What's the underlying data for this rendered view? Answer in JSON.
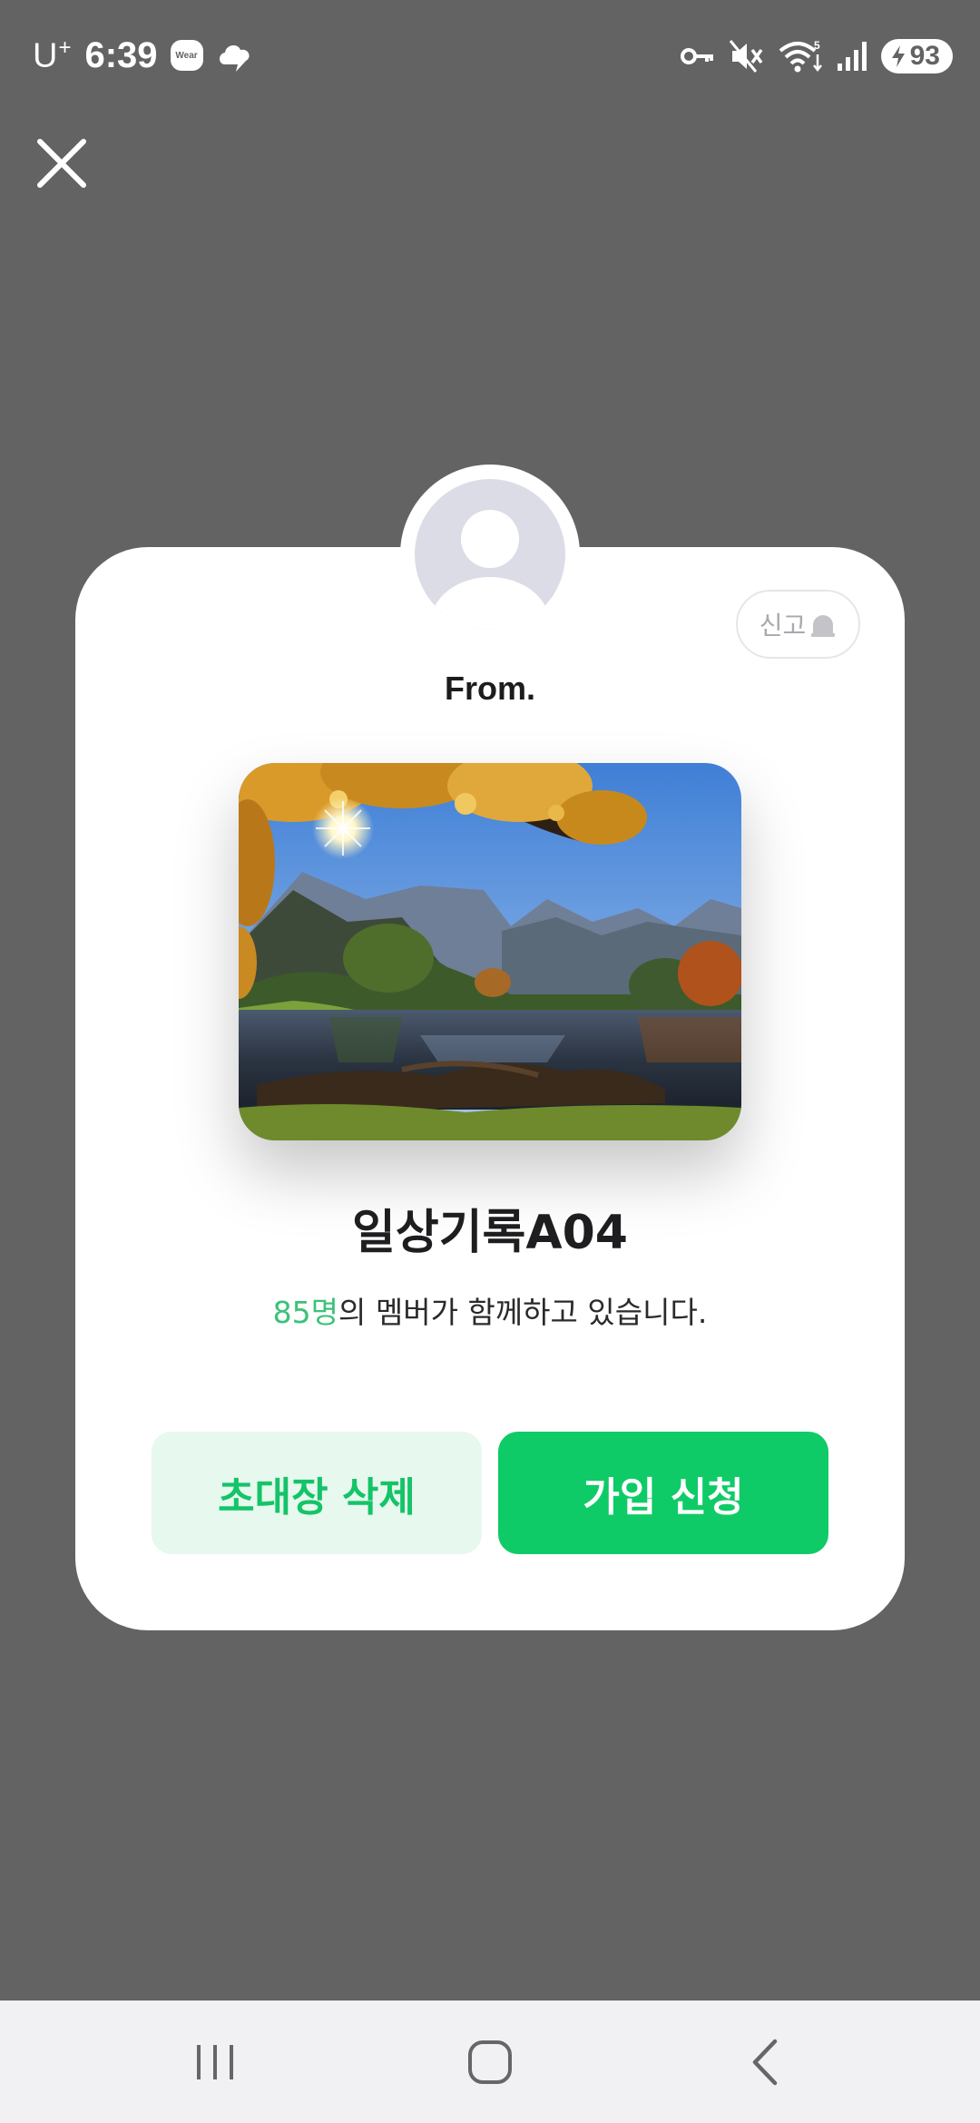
{
  "status_bar": {
    "carrier": "U",
    "carrier_sup": "+",
    "time": "6:39",
    "wear_badge": "Wear",
    "battery": "93"
  },
  "card": {
    "report_label": "신고",
    "from_label": "From.",
    "group_name": "일상기록A04",
    "member_count": "85명",
    "member_suffix": "의 멤버가 함께하고 있습니다.",
    "delete_button": "초대장 삭제",
    "join_button": "가입 신청"
  },
  "colors": {
    "backdrop": "#636363",
    "accent_green": "#0fcb67",
    "light_green": "#e7f8ee"
  },
  "icons": {
    "close": "close-icon",
    "key": "key-icon",
    "mute": "mute-icon",
    "wifi": "wifi-icon",
    "signal": "signal-icon",
    "recents": "recents-icon",
    "home": "home-icon",
    "back": "back-icon"
  }
}
